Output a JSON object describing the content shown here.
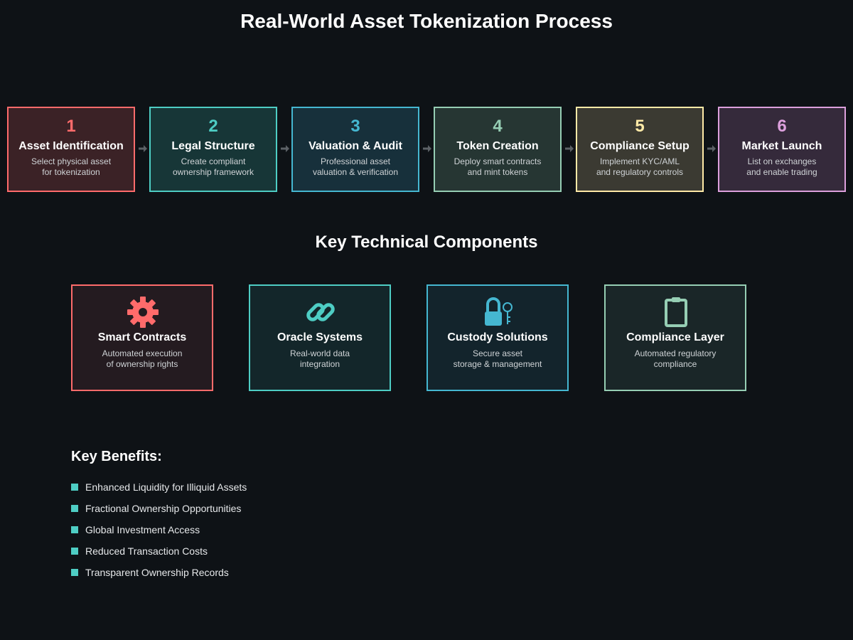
{
  "title": "Real-World Asset Tokenization Process",
  "steps": [
    {
      "number": "1",
      "title": "Asset Identification",
      "desc1": "Select physical asset",
      "desc2": "for tokenization",
      "color": "#ff6b6b",
      "bg": "#3b2226"
    },
    {
      "number": "2",
      "title": "Legal Structure",
      "desc1": "Create compliant",
      "desc2": "ownership framework",
      "color": "#4ecdc4",
      "bg": "#173637"
    },
    {
      "number": "3",
      "title": "Valuation & Audit",
      "desc1": "Professional asset",
      "desc2": "valuation & verification",
      "color": "#45b7d1",
      "bg": "#17303b"
    },
    {
      "number": "4",
      "title": "Token Creation",
      "desc1": "Deploy smart contracts",
      "desc2": "and mint tokens",
      "color": "#96ceb4",
      "bg": "#263633"
    },
    {
      "number": "5",
      "title": "Compliance Setup",
      "desc1": "Implement KYC/AML",
      "desc2": "and regulatory controls",
      "color": "#ffeaa7",
      "bg": "#3b3a32"
    },
    {
      "number": "6",
      "title": "Market Launch",
      "desc1": "List on exchanges",
      "desc2": "and enable trading",
      "color": "#dda0dd",
      "bg": "#352a3b"
    }
  ],
  "components_title": "Key Technical Components",
  "components": [
    {
      "icon": "gear-icon",
      "title": "Smart Contracts",
      "desc1": "Automated execution",
      "desc2": "of ownership rights",
      "color": "#ff6b6b",
      "bg": "#241b20"
    },
    {
      "icon": "link-icon",
      "title": "Oracle Systems",
      "desc1": "Real-world data",
      "desc2": "integration",
      "color": "#4ecdc4",
      "bg": "#13262a"
    },
    {
      "icon": "lock-key-icon",
      "title": "Custody Solutions",
      "desc1": "Secure asset",
      "desc2": "storage & management",
      "color": "#45b7d1",
      "bg": "#13242c"
    },
    {
      "icon": "clipboard-icon",
      "title": "Compliance Layer",
      "desc1": "Automated regulatory",
      "desc2": "compliance",
      "color": "#96ceb4",
      "bg": "#1a2628"
    }
  ],
  "benefits_title": "Key Benefits:",
  "benefits": [
    "Enhanced Liquidity for Illiquid Assets",
    "Fractional Ownership Opportunities",
    "Global Investment Access",
    "Reduced Transaction Costs",
    "Transparent Ownership Records"
  ],
  "bullet_color": "#4ecdc4",
  "arrow_color": "#5c6166"
}
